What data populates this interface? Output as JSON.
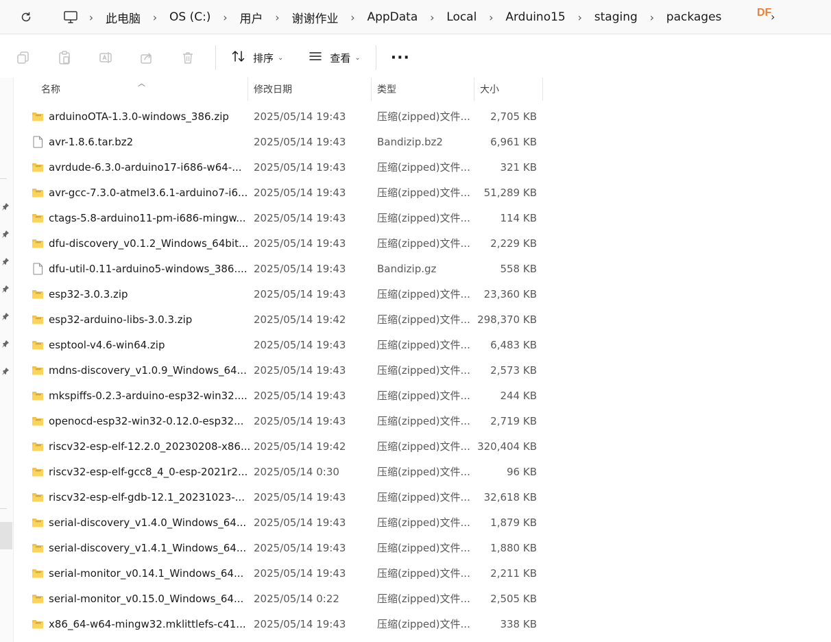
{
  "address_bar": {
    "breadcrumbs": [
      "此电脑",
      "OS (C:)",
      "用户",
      "谢谢作业",
      "AppData",
      "Local",
      "Arduino15",
      "staging",
      "packages"
    ],
    "watermark": "DF"
  },
  "toolbar": {
    "sort_label": "排序",
    "view_label": "查看",
    "more_label": "···"
  },
  "columns": {
    "name": "名称",
    "date": "修改日期",
    "type": "类型",
    "size": "大小"
  },
  "files": [
    {
      "name": "arduinoOTA-1.3.0-windows_386.zip",
      "date": "2025/05/14 19:43",
      "type": "压缩(zipped)文件...",
      "size": "2,705 KB",
      "icon": "zip-folder-icon"
    },
    {
      "name": "avr-1.8.6.tar.bz2",
      "date": "2025/05/14 19:43",
      "type": "Bandizip.bz2",
      "size": "6,961 KB",
      "icon": "file-icon"
    },
    {
      "name": "avrdude-6.3.0-arduino17-i686-w64-...",
      "date": "2025/05/14 19:43",
      "type": "压缩(zipped)文件...",
      "size": "321 KB",
      "icon": "zip-folder-icon"
    },
    {
      "name": "avr-gcc-7.3.0-atmel3.6.1-arduino7-i6...",
      "date": "2025/05/14 19:43",
      "type": "压缩(zipped)文件...",
      "size": "51,289 KB",
      "icon": "zip-folder-icon"
    },
    {
      "name": "ctags-5.8-arduino11-pm-i686-mingw...",
      "date": "2025/05/14 19:43",
      "type": "压缩(zipped)文件...",
      "size": "114 KB",
      "icon": "zip-folder-icon"
    },
    {
      "name": "dfu-discovery_v0.1.2_Windows_64bit...",
      "date": "2025/05/14 19:43",
      "type": "压缩(zipped)文件...",
      "size": "2,229 KB",
      "icon": "zip-folder-icon"
    },
    {
      "name": "dfu-util-0.11-arduino5-windows_386....",
      "date": "2025/05/14 19:43",
      "type": "Bandizip.gz",
      "size": "558 KB",
      "icon": "file-icon"
    },
    {
      "name": "esp32-3.0.3.zip",
      "date": "2025/05/14 19:43",
      "type": "压缩(zipped)文件...",
      "size": "23,360 KB",
      "icon": "zip-folder-icon"
    },
    {
      "name": "esp32-arduino-libs-3.0.3.zip",
      "date": "2025/05/14 19:42",
      "type": "压缩(zipped)文件...",
      "size": "298,370 KB",
      "icon": "zip-folder-icon"
    },
    {
      "name": "esptool-v4.6-win64.zip",
      "date": "2025/05/14 19:43",
      "type": "压缩(zipped)文件...",
      "size": "6,483 KB",
      "icon": "zip-folder-icon"
    },
    {
      "name": "mdns-discovery_v1.0.9_Windows_64...",
      "date": "2025/05/14 19:43",
      "type": "压缩(zipped)文件...",
      "size": "2,573 KB",
      "icon": "zip-folder-icon"
    },
    {
      "name": "mkspiffs-0.2.3-arduino-esp32-win32....",
      "date": "2025/05/14 19:43",
      "type": "压缩(zipped)文件...",
      "size": "244 KB",
      "icon": "zip-folder-icon"
    },
    {
      "name": "openocd-esp32-win32-0.12.0-esp32...",
      "date": "2025/05/14 19:43",
      "type": "压缩(zipped)文件...",
      "size": "2,719 KB",
      "icon": "zip-folder-icon"
    },
    {
      "name": "riscv32-esp-elf-12.2.0_20230208-x86...",
      "date": "2025/05/14 19:42",
      "type": "压缩(zipped)文件...",
      "size": "320,404 KB",
      "icon": "zip-folder-icon"
    },
    {
      "name": "riscv32-esp-elf-gcc8_4_0-esp-2021r2...",
      "date": "2025/05/14 0:30",
      "type": "压缩(zipped)文件...",
      "size": "96 KB",
      "icon": "zip-folder-icon"
    },
    {
      "name": "riscv32-esp-elf-gdb-12.1_20231023-...",
      "date": "2025/05/14 19:43",
      "type": "压缩(zipped)文件...",
      "size": "32,618 KB",
      "icon": "zip-folder-icon"
    },
    {
      "name": "serial-discovery_v1.4.0_Windows_64...",
      "date": "2025/05/14 19:43",
      "type": "压缩(zipped)文件...",
      "size": "1,879 KB",
      "icon": "zip-folder-icon"
    },
    {
      "name": "serial-discovery_v1.4.1_Windows_64...",
      "date": "2025/05/14 19:43",
      "type": "压缩(zipped)文件...",
      "size": "1,880 KB",
      "icon": "zip-folder-icon"
    },
    {
      "name": "serial-monitor_v0.14.1_Windows_64...",
      "date": "2025/05/14 19:43",
      "type": "压缩(zipped)文件...",
      "size": "2,211 KB",
      "icon": "zip-folder-icon"
    },
    {
      "name": "serial-monitor_v0.15.0_Windows_64...",
      "date": "2025/05/14 0:22",
      "type": "压缩(zipped)文件...",
      "size": "2,505 KB",
      "icon": "zip-folder-icon"
    },
    {
      "name": "x86_64-w64-mingw32.mklittlefs-c41...",
      "date": "2025/05/14 19:43",
      "type": "压缩(zipped)文件...",
      "size": "338 KB",
      "icon": "zip-folder-icon"
    }
  ]
}
